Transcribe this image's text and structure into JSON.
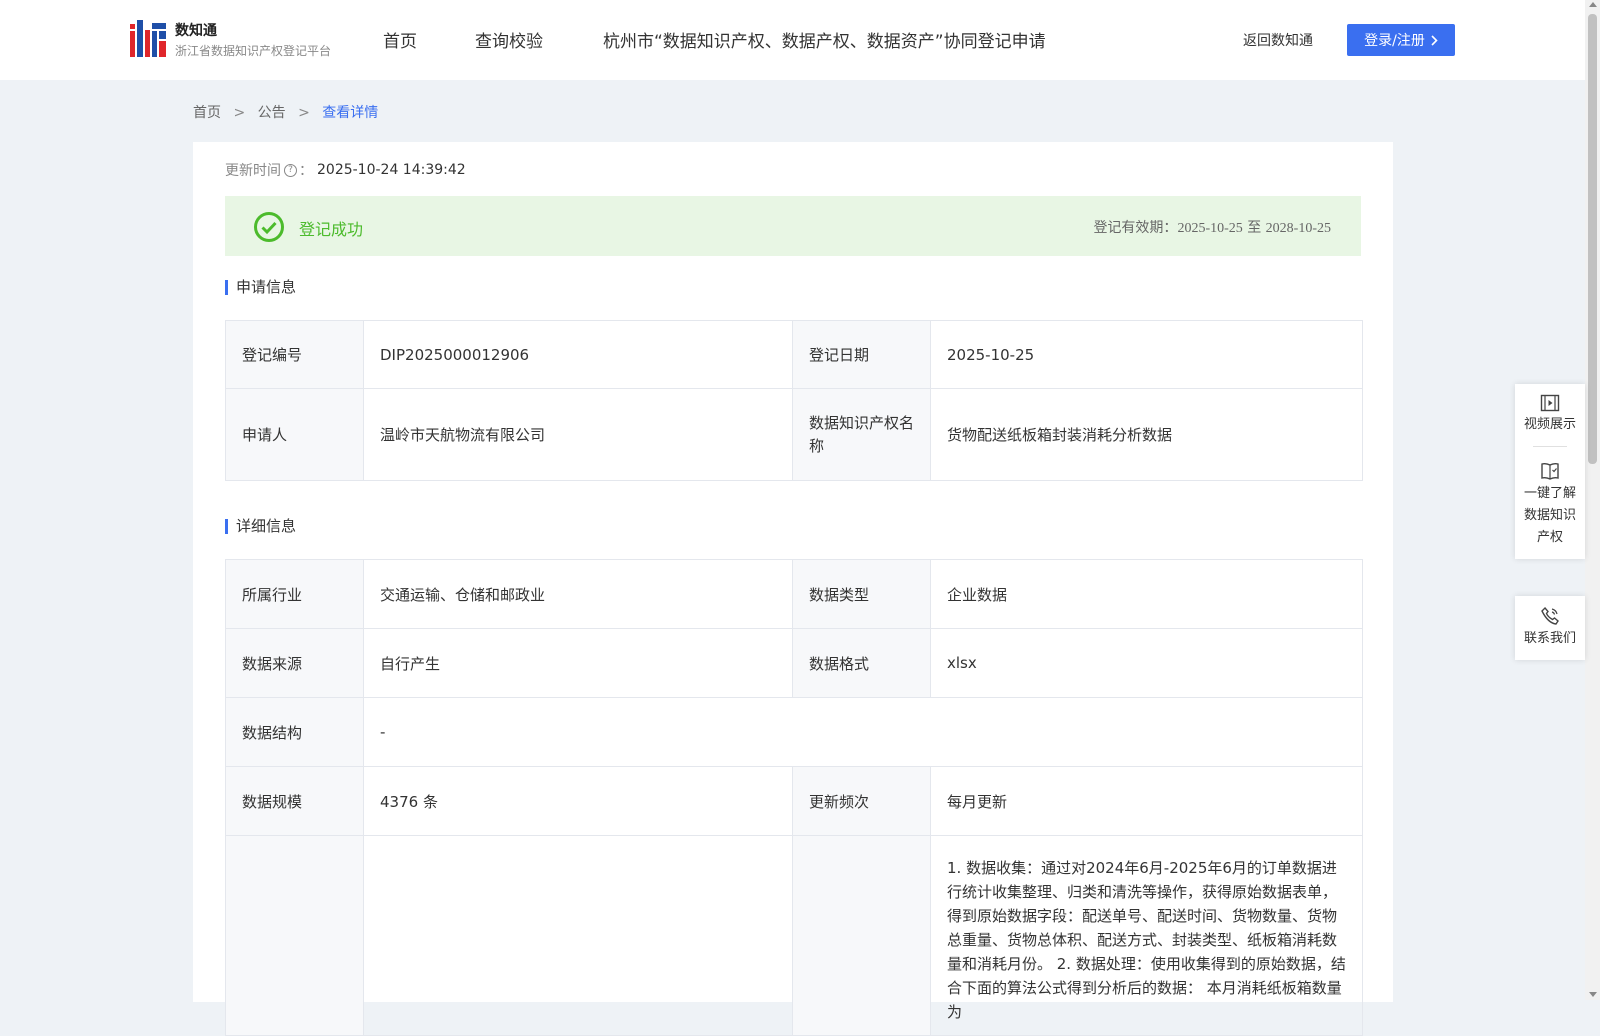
{
  "header": {
    "logo_title": "数知通",
    "logo_subtitle": "浙江省数据知识产权登记平台",
    "nav": [
      "首页",
      "查询校验",
      "杭州市“数据知识产权、数据产权、数据资产”协同登记申请"
    ],
    "back_label": "返回数知通",
    "login_label": "登录/注册"
  },
  "breadcrumb": [
    "首页",
    "公告",
    "查看详情"
  ],
  "update": {
    "label": "更新时间",
    "value": "2025-10-24 14:39:42"
  },
  "status": {
    "text": "登记成功",
    "validity_label": "登记有效期：",
    "validity_start": "2025-10-25",
    "validity_mid": "至",
    "validity_end": "2028-10-25",
    "color": "#4cbb2c"
  },
  "application": {
    "title": "申请信息",
    "reg_no_label": "登记编号",
    "reg_no": "DIP2025000012906",
    "reg_date_label": "登记日期",
    "reg_date": "2025-10-25",
    "applicant_label": "申请人",
    "applicant": "温岭市天航物流有限公司",
    "ip_name_label": "数据知识产权名称",
    "ip_name": "货物配送纸板箱封装消耗分析数据"
  },
  "details": {
    "title": "详细信息",
    "industry_label": "所属行业",
    "industry": "交通运输、仓储和邮政业",
    "data_type_label": "数据类型",
    "data_type": "企业数据",
    "source_label": "数据来源",
    "source": "自行产生",
    "format_label": "数据格式",
    "format": "xlsx",
    "structure_label": "数据结构",
    "structure": "-",
    "scale_label": "数据规模",
    "scale": "4376 条",
    "frequency_label": "更新频次",
    "frequency": "每月更新",
    "process_text": "1. 数据收集：通过对2024年6月-2025年6月的订单数据进行统计收集整理、归类和清洗等操作，获得原始数据表单，得到原始数据字段：配送单号、配送时间、货物数量、货物总重量、货物总体积、配送方式、封装类型、纸板箱消耗数量和消耗月份。 2. 数据处理：使用收集得到的原始数据，结合下面的算法公式得到分析后的数据： 本月消耗纸板箱数量为"
  },
  "float": {
    "video": "视频展示",
    "learn": "一键了解数据知识产权",
    "contact": "联系我们"
  },
  "colors": {
    "accent": "#3a6ff0",
    "success_bg": "#e8f6e4"
  }
}
